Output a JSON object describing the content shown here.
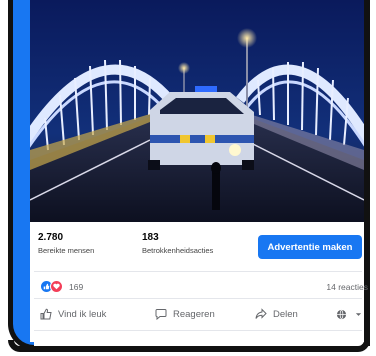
{
  "photo": {
    "description_icon": "police-car-on-bridge-photo"
  },
  "stats": {
    "reach_value": "2.780",
    "reach_label": "Bereikte mensen",
    "engagement_value": "183",
    "engagement_label": "Betrokkenheidsacties"
  },
  "cta": {
    "label": "Advertentie maken"
  },
  "reactions": {
    "count": "169",
    "comments": "14 reacties"
  },
  "actions": {
    "like": "Vind ik leuk",
    "comment": "Reageren",
    "share": "Delen"
  },
  "colors": {
    "accent": "#1877f2",
    "love": "#f33e58"
  }
}
